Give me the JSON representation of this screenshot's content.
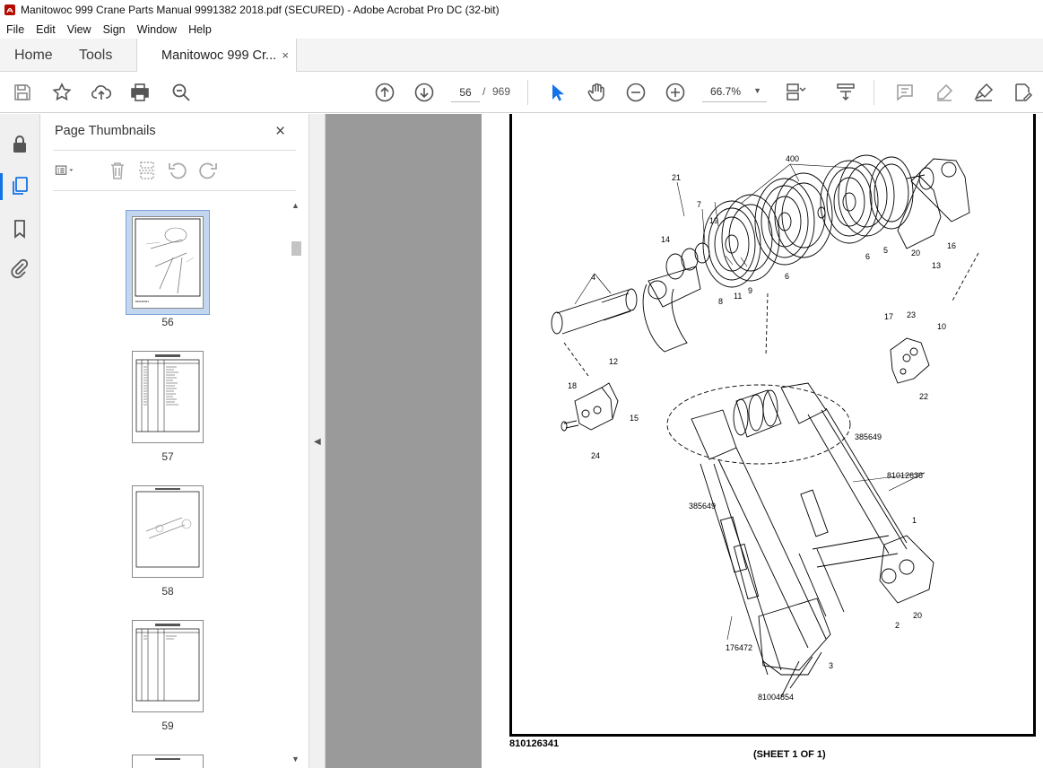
{
  "window": {
    "title": "Manitowoc 999 Crane Parts Manual 9991382 2018.pdf (SECURED) - Adobe Acrobat Pro DC (32-bit)"
  },
  "menu": [
    "File",
    "Edit",
    "View",
    "Sign",
    "Window",
    "Help"
  ],
  "tabs": {
    "home": "Home",
    "tools": "Tools",
    "document": "Manitowoc 999 Cr...",
    "close_glyph": "×"
  },
  "toolbar": {
    "icons": [
      "save-icon",
      "bookmark-star-icon",
      "upload-icon",
      "print-icon",
      "zoom-search-icon",
      "page-up-icon",
      "page-down-icon",
      "select-cursor-icon",
      "hand-icon",
      "zoom-out-icon",
      "zoom-in-icon",
      "page-layout-icon",
      "scroll-mode-icon",
      "comment-icon",
      "highlight-icon",
      "sign-icon",
      "edit-pdf-icon"
    ],
    "current_page": "56",
    "page_separator": "/",
    "total_pages": "969",
    "zoom": "66.7%"
  },
  "sidebar_panel": {
    "title": "Page Thumbnails",
    "close_glyph": "×",
    "thumbnails": [
      {
        "label": "56",
        "selected": true
      },
      {
        "label": "57",
        "selected": false
      },
      {
        "label": "58",
        "selected": false
      },
      {
        "label": "59",
        "selected": false
      }
    ]
  },
  "document": {
    "drawing_number": "810126341",
    "sheet_label": "(SHEET 1 OF 1)",
    "callouts": [
      "400",
      "21",
      "7",
      "19",
      "14",
      "4",
      "8",
      "11",
      "9",
      "6",
      "6",
      "5",
      "20",
      "13",
      "16",
      "17",
      "23",
      "10",
      "22",
      "12",
      "18",
      "15",
      "24",
      "385649",
      "81012636",
      "385649",
      "1",
      "2",
      "20",
      "3",
      "176472",
      "81004854"
    ]
  },
  "colors": {
    "accent_blue": "#1473e6",
    "doc_background": "#9a9a9a",
    "tab_bar": "#f4f4f4"
  }
}
